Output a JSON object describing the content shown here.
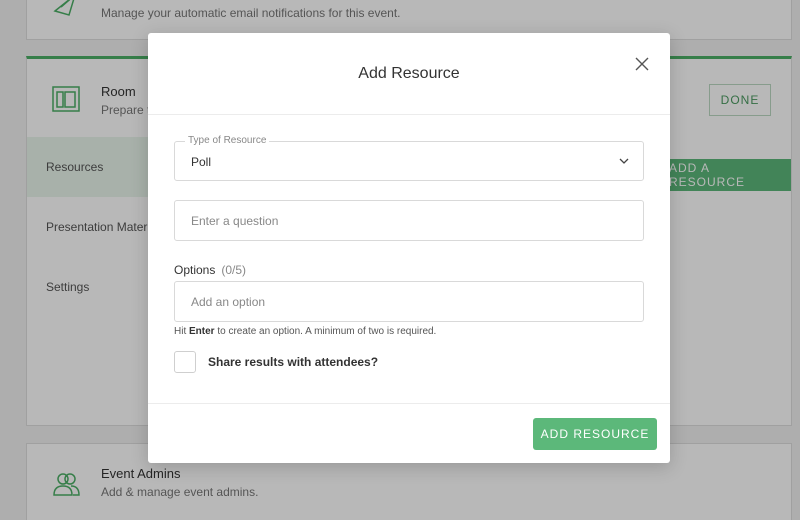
{
  "background": {
    "notifications": {
      "subtitle": "Manage your automatic email notifications for this event."
    },
    "room": {
      "title": "Room",
      "subtitle": "Prepare t",
      "done_label": "DONE",
      "nav": [
        "Resources",
        "Presentation Mater",
        "Settings"
      ],
      "add_resource_label": "ADD A RESOURCE"
    },
    "admins": {
      "title": "Event Admins",
      "subtitle": "Add & manage event admins."
    }
  },
  "modal": {
    "title": "Add Resource",
    "type_label": "Type of Resource",
    "type_value": "Poll",
    "question_placeholder": "Enter a question",
    "options_label": "Options",
    "options_count": "(0/5)",
    "option_placeholder": "Add an option",
    "hint_pre": "Hit ",
    "hint_key": "Enter",
    "hint_post": " to create an option. A minimum of two is required.",
    "share_label": "Share results with attendees?",
    "submit_label": "ADD RESOURCE"
  },
  "colors": {
    "accent": "#5cb87a",
    "overlay": "rgba(0,0,0,0.28)"
  },
  "icons": [
    "email-icon",
    "room-icon",
    "admins-icon",
    "close-icon",
    "chevron-down-icon"
  ]
}
